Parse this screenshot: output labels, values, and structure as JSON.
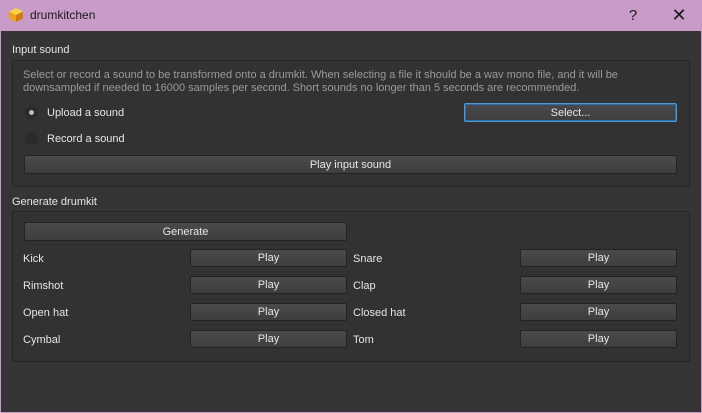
{
  "window": {
    "title": "drumkitchen",
    "help_glyph": "?",
    "close_glyph": "✕"
  },
  "input_group": {
    "title": "Input sound",
    "description": "Select or record a sound to be transformed onto a drumkit. When selecting a file it should be a wav mono file, and it will be downsampled if needed to 16000 samples per second. Short sounds no longer than 5 seconds are recommended.",
    "upload_label": "Upload a sound",
    "record_label": "Record a sound",
    "selected_option": "Upload a sound",
    "select_button": "Select...",
    "play_input_button": "Play input sound"
  },
  "generate_group": {
    "title": "Generate drumkit",
    "generate_button": "Generate",
    "play_label": "Play",
    "left_drums": [
      "Kick",
      "Rimshot",
      "Open hat",
      "Cymbal"
    ],
    "right_drums": [
      "Snare",
      "Clap",
      "Closed hat",
      "Tom"
    ]
  }
}
